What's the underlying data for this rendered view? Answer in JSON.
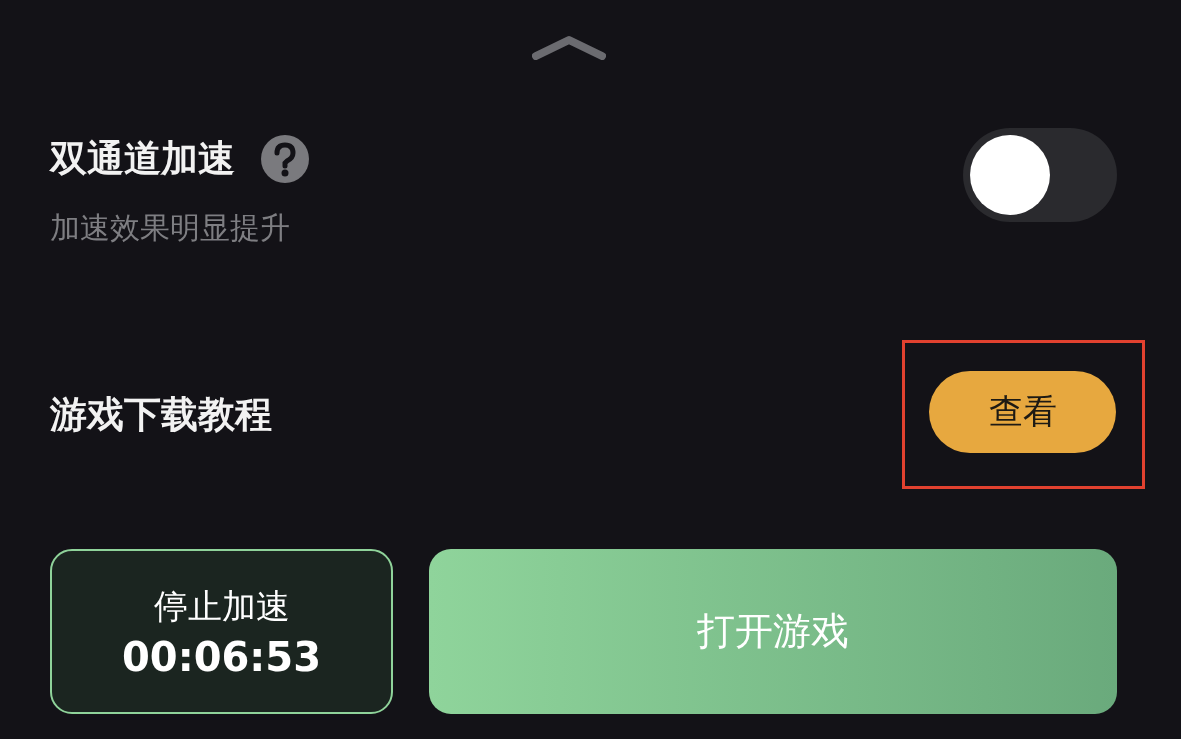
{
  "panel": {
    "collapse_handle": true
  },
  "settings": [
    {
      "kind": "toggle",
      "title": "双通道加速",
      "help": true,
      "subtitle": "加速效果明显提升",
      "on": false
    },
    {
      "kind": "action",
      "title": "游戏下载教程",
      "button": "查看",
      "highlighted": true
    }
  ],
  "footer": {
    "stop_button": {
      "label": "停止加速",
      "timer": "00:06:53"
    },
    "open_button": {
      "label": "打开游戏"
    }
  }
}
